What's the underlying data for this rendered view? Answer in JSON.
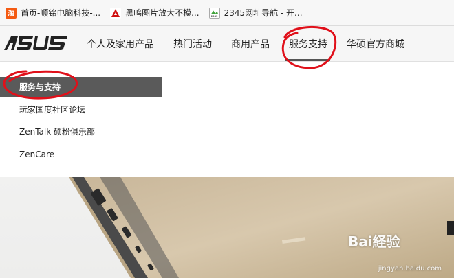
{
  "bookmarks": [
    {
      "icon": "taobao-icon",
      "label": "首页-顺铭电脑科技-..."
    },
    {
      "icon": "heiming-icon",
      "label": "黑鸣图片放大不模..."
    },
    {
      "icon": "2345-icon",
      "label": "2345网址导航 - 开..."
    }
  ],
  "nav": {
    "logo": "ASUS",
    "items": [
      "个人及家用产品",
      "热门活动",
      "商用产品",
      "服务支持",
      "华硕官方商城"
    ],
    "active": "服务支持"
  },
  "dropdown": {
    "items": [
      "服务与支持",
      "玩家国度社区论坛",
      "ZenTalk 硕粉俱乐部",
      "ZenCare"
    ],
    "active_index": 0
  },
  "watermark": {
    "brand": "Bai経验",
    "url": "jingyan.baidu.com"
  },
  "colors": {
    "annotation": "#e0101a",
    "active_bg": "#5a5a5a"
  }
}
